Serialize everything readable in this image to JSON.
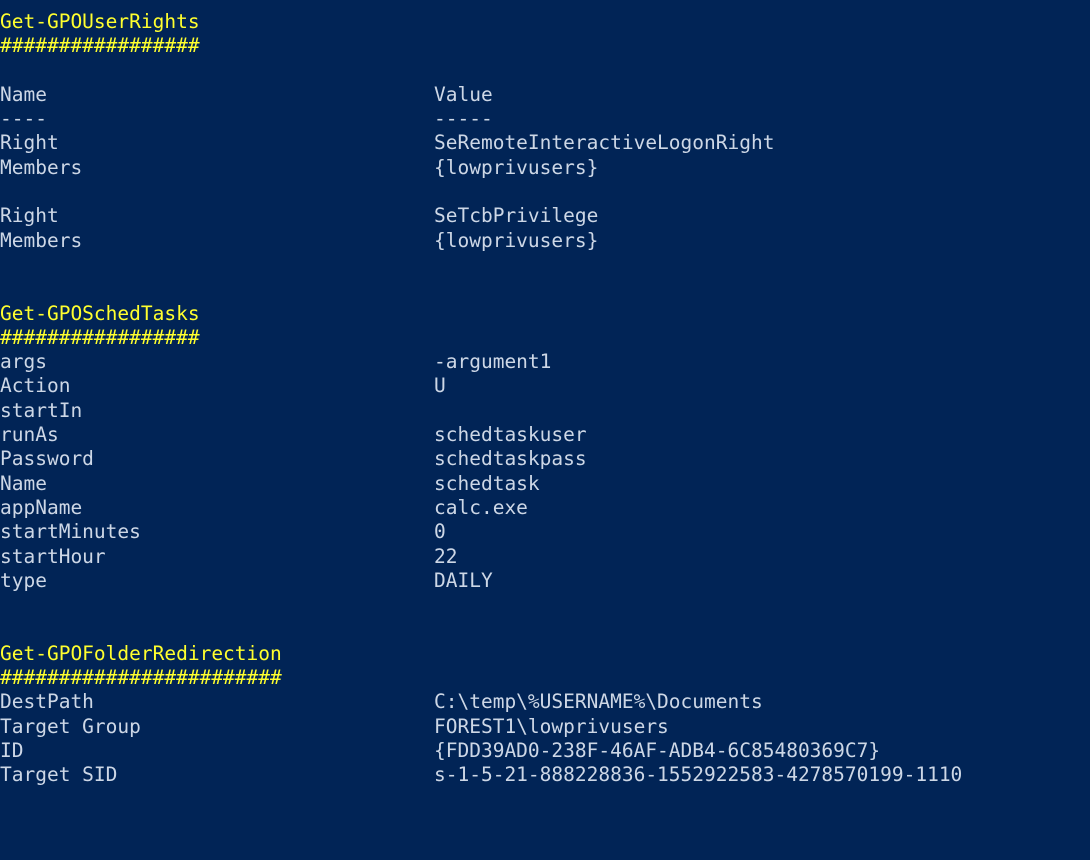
{
  "console": {
    "background_color": "#012456",
    "header_color": "#ffff2e",
    "text_color": "#cdd7e6",
    "blank": ""
  },
  "sections": [
    {
      "title": "Get-GPOUserRights",
      "underline": "#################",
      "table_header": {
        "name": "Name",
        "value": "Value"
      },
      "table_rule": {
        "name": "----",
        "value": "-----"
      },
      "rows": [
        {
          "name": "Right",
          "value": "SeRemoteInteractiveLogonRight"
        },
        {
          "name": "Members",
          "value": "{lowprivusers}"
        },
        {
          "name": "",
          "value": ""
        },
        {
          "name": "Right",
          "value": "SeTcbPrivilege"
        },
        {
          "name": "Members",
          "value": "{lowprivusers}"
        }
      ]
    },
    {
      "title": "Get-GPOSchedTasks",
      "underline": "#################",
      "rows": [
        {
          "name": "args",
          "value": "-argument1"
        },
        {
          "name": "Action",
          "value": "U"
        },
        {
          "name": "startIn",
          "value": ""
        },
        {
          "name": "runAs",
          "value": "schedtaskuser"
        },
        {
          "name": "Password",
          "value": "schedtaskpass"
        },
        {
          "name": "Name",
          "value": "schedtask"
        },
        {
          "name": "appName",
          "value": "calc.exe"
        },
        {
          "name": "startMinutes",
          "value": "0"
        },
        {
          "name": "startHour",
          "value": "22"
        },
        {
          "name": "type",
          "value": "DAILY"
        }
      ]
    },
    {
      "title": "Get-GPOFolderRedirection",
      "underline": "########################",
      "rows": [
        {
          "name": "DestPath",
          "value": "C:\\temp\\%USERNAME%\\Documents"
        },
        {
          "name": "Target Group",
          "value": "FOREST1\\lowprivusers"
        },
        {
          "name": "ID",
          "value": "{FDD39AD0-238F-46AF-ADB4-6C85480369C7}"
        },
        {
          "name": "Target SID",
          "value": "s-1-5-21-888228836-1552922583-4278570199-1110"
        }
      ]
    }
  ]
}
